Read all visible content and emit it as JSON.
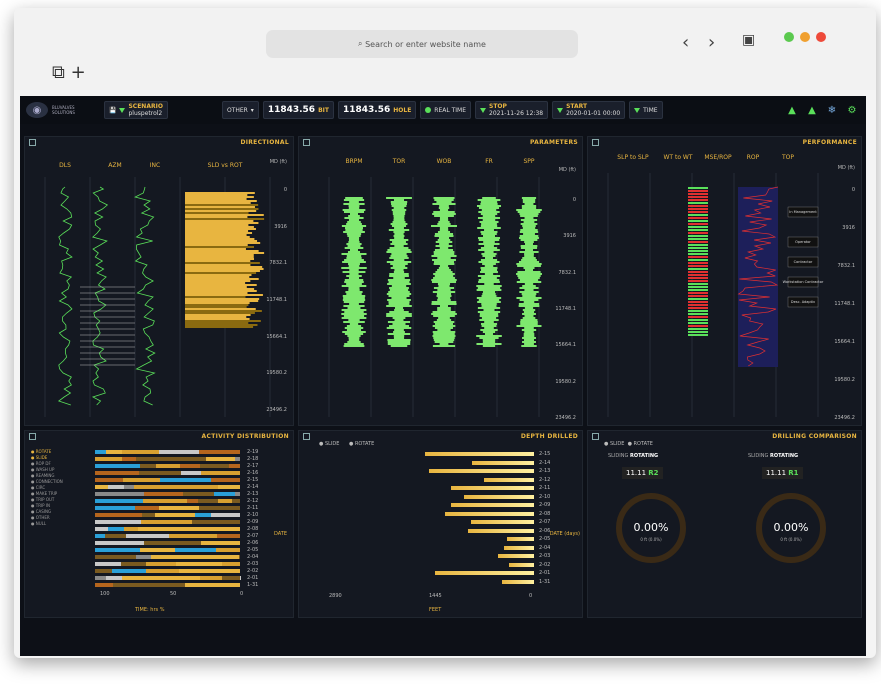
{
  "browser": {
    "url_placeholder": "Search or enter website name",
    "back": "‹",
    "forward": "›",
    "tab_icons": "⧉ +"
  },
  "header": {
    "performance_label": "PERFORMANCE",
    "time_label": "TIME",
    "start_label": "START",
    "start_value": "2020-01-01 00:00",
    "stop_label": "STOP",
    "stop_value": "2021-11-26 12:38",
    "realtime_label": "REAL TIME",
    "hole_label": "HOLE",
    "hole_value": "11843.56",
    "bit_label": "BIT",
    "bit_value": "11843.56",
    "other_label": "OTHER",
    "scenario_label": "SCENARIO",
    "scenario_value": "pluspetrol2",
    "brand": "BLUVALVES SOLUTIONS"
  },
  "panels": {
    "performance": {
      "title": "PERFORMANCE",
      "md": "MD (ft)",
      "cols": [
        "TOP",
        "ROP",
        "MSE/ROP",
        "WT to WT",
        "SLP to SLP"
      ],
      "depths": [
        "0",
        "3916",
        "7832.1",
        "11748.1",
        "15664.1",
        "19580.2",
        "23496.2"
      ],
      "annotations": [
        "In Management",
        "Operator",
        "Contractor",
        "Workstation Contractor",
        "Desc. Adaptiv"
      ]
    },
    "parameters": {
      "title": "PARAMETERS",
      "cols": [
        "SPP",
        "FR",
        "WOB",
        "TOR",
        "BRPM"
      ],
      "md": "MD (ft)",
      "depths": [
        "0",
        "3916",
        "7832.1",
        "11748.1",
        "15664.1",
        "19580.2",
        "23496.2"
      ]
    },
    "directional": {
      "title": "DIRECTIONAL",
      "cols": [
        "SLD vs ROT",
        "INC",
        "AZM",
        "DLS"
      ],
      "md": "MD (ft)",
      "depths": [
        "0",
        "3916",
        "7832.1",
        "11748.1",
        "15664.1",
        "19580.2",
        "23496.2"
      ]
    },
    "drilling_comparison": {
      "title": "DRILLING COMPARISON",
      "legend_rotate": "ROTATE",
      "legend_slide": "SLIDE",
      "r1": {
        "rotating": "ROTATING",
        "sliding": "SLIDING",
        "label": "R1",
        "value": "11.11",
        "pct": "0.00%",
        "sub": "0 ft (0.0%)"
      },
      "r2": {
        "rotating": "ROTATING",
        "sliding": "SLIDING",
        "label": "R2",
        "value": "11.11",
        "pct": "0.00%",
        "sub": "0 ft (0.0%)"
      }
    },
    "depth_drilled": {
      "title": "DEPTH DRILLED",
      "legend_rotate": "ROTATE",
      "legend_slide": "SLIDE",
      "xlabel": "FEET",
      "ylabel": "DATE (days)",
      "xticks": [
        "0",
        "1445",
        "2890"
      ],
      "dates": [
        "2-15",
        "2-14",
        "2-13",
        "2-12",
        "2-11",
        "2-10",
        "2-09",
        "2-08",
        "2-07",
        "2-06",
        "2-05",
        "2-04",
        "2-03",
        "2-02",
        "2-01",
        "1-31"
      ]
    },
    "activity": {
      "title": "ACTIVITY DISTRIBUTION",
      "ylabel": "DATE",
      "xlabel": "TIME: hrs %",
      "xticks": [
        "0",
        "50",
        "100"
      ],
      "dates": [
        "2-19",
        "2-18",
        "2-17",
        "2-16",
        "2-15",
        "2-14",
        "2-13",
        "2-12",
        "2-11",
        "2-10",
        "2-09",
        "2-08",
        "2-07",
        "2-06",
        "2-05",
        "2-04",
        "2-03",
        "2-02",
        "2-01",
        "1-31"
      ],
      "legend": [
        "ROTATE",
        "SLIDE",
        "ROP DF",
        "WASH UP",
        "REAMING",
        "CONNECTION",
        "CIRC",
        "MAKE TRIP",
        "TRIP OUT",
        "TRIP IN",
        "CASING",
        "OTHER",
        "NULL"
      ]
    }
  },
  "colors": {
    "accent": "#e8b540",
    "green": "#5ae05a",
    "bg": "#0d1017"
  }
}
